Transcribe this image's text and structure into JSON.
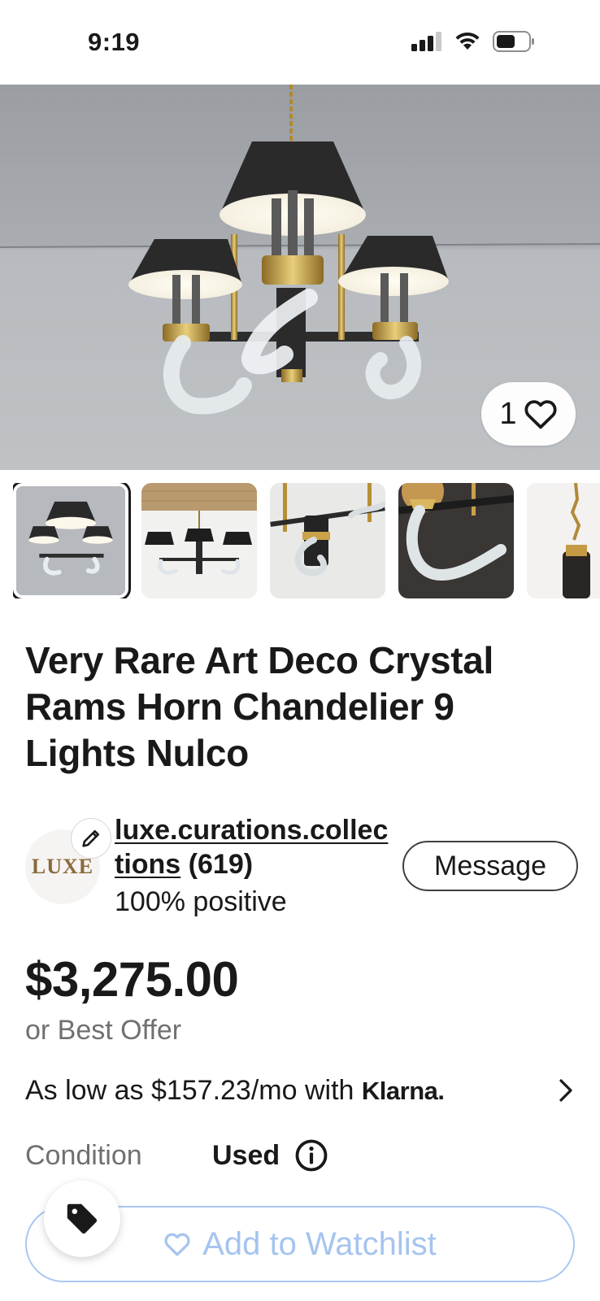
{
  "status_bar": {
    "time": "9:19",
    "icons": [
      "cellular-signal-icon",
      "wifi-icon",
      "battery-icon"
    ]
  },
  "gallery": {
    "watch_count": "1",
    "thumbnail_count": 5,
    "selected_index": 0
  },
  "listing": {
    "title": "Very Rare Art Deco Crystal Rams Horn Chandelier 9 Lights Nulco",
    "price": "$3,275.00",
    "price_subtext": "or Best Offer"
  },
  "seller": {
    "avatar_text": "LUXE",
    "name": "luxe.curations.collections",
    "feedback_count": "(619)",
    "positive": "100% positive",
    "message_label": "Message"
  },
  "financing": {
    "text": "As low as $157.23/mo with",
    "brand": "Klarna."
  },
  "condition": {
    "label": "Condition",
    "value": "Used"
  },
  "actions": {
    "watchlist_label": "Add to Watchlist"
  },
  "colors": {
    "text": "#191919",
    "muted": "#707070",
    "watchlist_blue": "#a5c4ef",
    "border": "#3f3f3f"
  }
}
